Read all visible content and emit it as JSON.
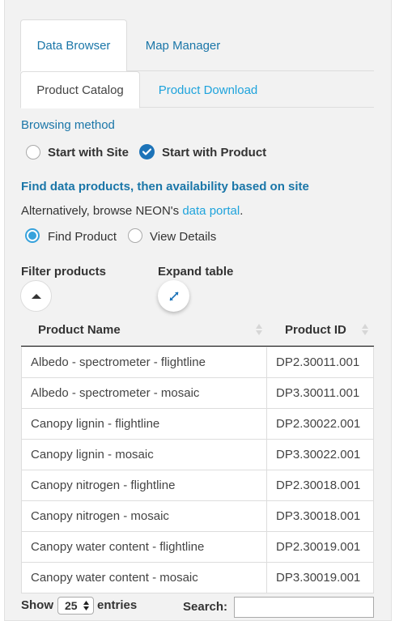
{
  "tabs": {
    "data_browser": "Data Browser",
    "map_manager": "Map Manager"
  },
  "subtabs": {
    "product_catalog": "Product Catalog",
    "product_download": "Product Download"
  },
  "browsing": {
    "heading": "Browsing method",
    "option_site": "Start with Site",
    "option_product": "Start with Product",
    "selected": "Start with Product"
  },
  "find": {
    "heading": "Find data products, then availability based on site",
    "alt_text": "Alternatively, browse NEON's",
    "portal_link": "data portal",
    "period": ".",
    "option_find": "Find Product",
    "option_details": "View Details",
    "selected": "Find Product"
  },
  "controls": {
    "filter_label": "Filter products",
    "expand_label": "Expand table"
  },
  "table": {
    "columns": [
      "Product Name",
      "Product ID"
    ],
    "rows": [
      [
        "Albedo - spectrometer - flightline",
        "DP2.30011.001"
      ],
      [
        "Albedo - spectrometer - mosaic",
        "DP3.30011.001"
      ],
      [
        "Canopy lignin - flightline",
        "DP2.30022.001"
      ],
      [
        "Canopy lignin - mosaic",
        "DP3.30022.001"
      ],
      [
        "Canopy nitrogen - flightline",
        "DP2.30018.001"
      ],
      [
        "Canopy nitrogen - mosaic",
        "DP3.30018.001"
      ],
      [
        "Canopy water content - flightline",
        "DP2.30019.001"
      ],
      [
        "Canopy water content - mosaic",
        "DP3.30019.001"
      ]
    ]
  },
  "footer": {
    "show": "Show",
    "entries_value": "25",
    "entries": "entries",
    "search": "Search:",
    "search_value": ""
  },
  "colors": {
    "link": "#1a76a8",
    "link_light": "#1ea3dc",
    "check": "#1c73b8",
    "radio": "#37a2dc"
  }
}
